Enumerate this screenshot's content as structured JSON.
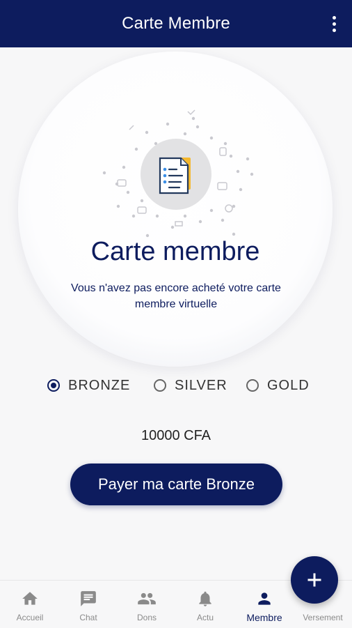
{
  "app_bar": {
    "title": "Carte Membre"
  },
  "hero": {
    "title": "Carte membre",
    "subtitle": "Vous n'avez pas encore acheté votre carte membre virtuelle",
    "illustration": "document-icon"
  },
  "tiers": {
    "selected": "BRONZE",
    "options": [
      {
        "label": "BRONZE",
        "checked": true
      },
      {
        "label": "SILVER",
        "checked": false
      },
      {
        "label": "GOLD",
        "checked": false
      }
    ]
  },
  "price": "10000 CFA",
  "pay_button": {
    "label": "Payer ma carte Bronze"
  },
  "bottom_nav": {
    "active": "Membre",
    "items": [
      {
        "label": "Accueil",
        "icon": "home-icon"
      },
      {
        "label": "Chat",
        "icon": "chat-icon"
      },
      {
        "label": "Dons",
        "icon": "people-icon"
      },
      {
        "label": "Actu",
        "icon": "bell-icon"
      },
      {
        "label": "Membre",
        "icon": "person-icon"
      },
      {
        "label": "Versement",
        "icon": "plus-icon"
      }
    ]
  },
  "colors": {
    "primary": "#0d1c5e",
    "accent": "#f5b82e",
    "background": "#f7f7f8"
  }
}
